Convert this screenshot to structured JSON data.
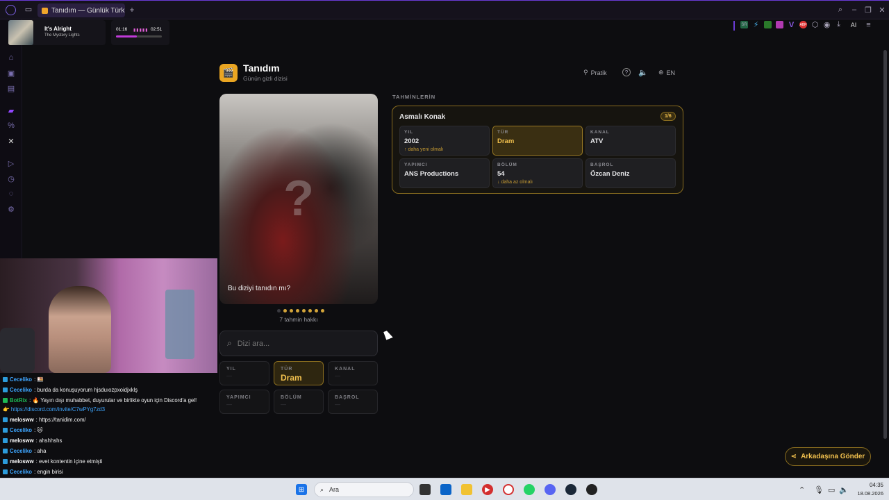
{
  "browser": {
    "tab_title": "Tanıdım — Günlük Türk Dizi",
    "new_tab": "+",
    "ai_label": "AI"
  },
  "music": {
    "title": "It's Alright",
    "artist": "The Mystery Lights",
    "elapsed": "01:16",
    "total": "02:51",
    "progress": 0.45
  },
  "app": {
    "name": "Tanıdım",
    "subtitle": "Günün gizli dizisi",
    "pratik_label": "Pratik",
    "lang_label": "EN",
    "prompt": "Bu diziyi tanıdın mı?",
    "guesses_left": "7 tahmin hakkı",
    "total_dots": 8,
    "used_dots": 1,
    "search_placeholder": "Dizi ara...",
    "send_button": "Arkadaşına Gönder"
  },
  "guesses": {
    "heading": "TAHMİNLERİN",
    "items": [
      {
        "title": "Asmalı Konak",
        "counter": "1/6",
        "cells": [
          {
            "key": "YIL",
            "value": "2002",
            "hint": "↑ daha yeni olmalı",
            "hit": false
          },
          {
            "key": "TÜR",
            "value": "Dram",
            "hint": "",
            "hit": true
          },
          {
            "key": "KANAL",
            "value": "ATV",
            "hint": "",
            "hit": false
          },
          {
            "key": "YAPIMCI",
            "value": "ANS Productions",
            "hint": "",
            "hit": false
          },
          {
            "key": "BÖLÜM",
            "value": "54",
            "hint": "↓ daha az olmalı",
            "hit": false
          },
          {
            "key": "BAŞROL",
            "value": "Özcan Deniz",
            "hint": "",
            "hit": false
          }
        ]
      }
    ]
  },
  "board": [
    {
      "key": "YIL",
      "value": "—",
      "hit": false
    },
    {
      "key": "TÜR",
      "value": "Dram",
      "hit": true
    },
    {
      "key": "KANAL",
      "value": "—",
      "hit": false
    },
    {
      "key": "YAPIMCI",
      "value": "—",
      "hit": false
    },
    {
      "key": "BÖLÜM",
      "value": "—",
      "hit": false
    },
    {
      "key": "BAŞROL",
      "value": "—",
      "hit": false
    }
  ],
  "chat": [
    {
      "nick": "Ceceliko",
      "color": "#3ea6ff",
      "text": ": 🍱"
    },
    {
      "nick": "Ceceliko",
      "color": "#3ea6ff",
      "text": ": burda da konuşuyorum hjsduıozpxoidjxklş"
    },
    {
      "nick": "BotRix",
      "color": "#1db954",
      "text": ": 🔥 Yayın dışı muhabbet, duyurular ve birlikte oyun için Discord'a gel!"
    },
    {
      "nick": "",
      "color": "#3ea6ff",
      "text": "👉 https://discord.com/invite/C7wPYg7zd3"
    },
    {
      "nick": "melosww",
      "color": "#ffffff",
      "text": ": https://tanidim.com/"
    },
    {
      "nick": "Ceceliko",
      "color": "#3ea6ff",
      "text": ": 🐱"
    },
    {
      "nick": "melosww",
      "color": "#ffffff",
      "text": ": ahshhshs"
    },
    {
      "nick": "Ceceliko",
      "color": "#3ea6ff",
      "text": ": aha"
    },
    {
      "nick": "melosww",
      "color": "#ffffff",
      "text": ": evet kontentin içine etmişti"
    },
    {
      "nick": "Ceceliko",
      "color": "#3ea6ff",
      "text": ": engin birisi"
    }
  ],
  "taskbar": {
    "search_label": "Ara",
    "time": "04:35",
    "date": "18.08.2026"
  }
}
